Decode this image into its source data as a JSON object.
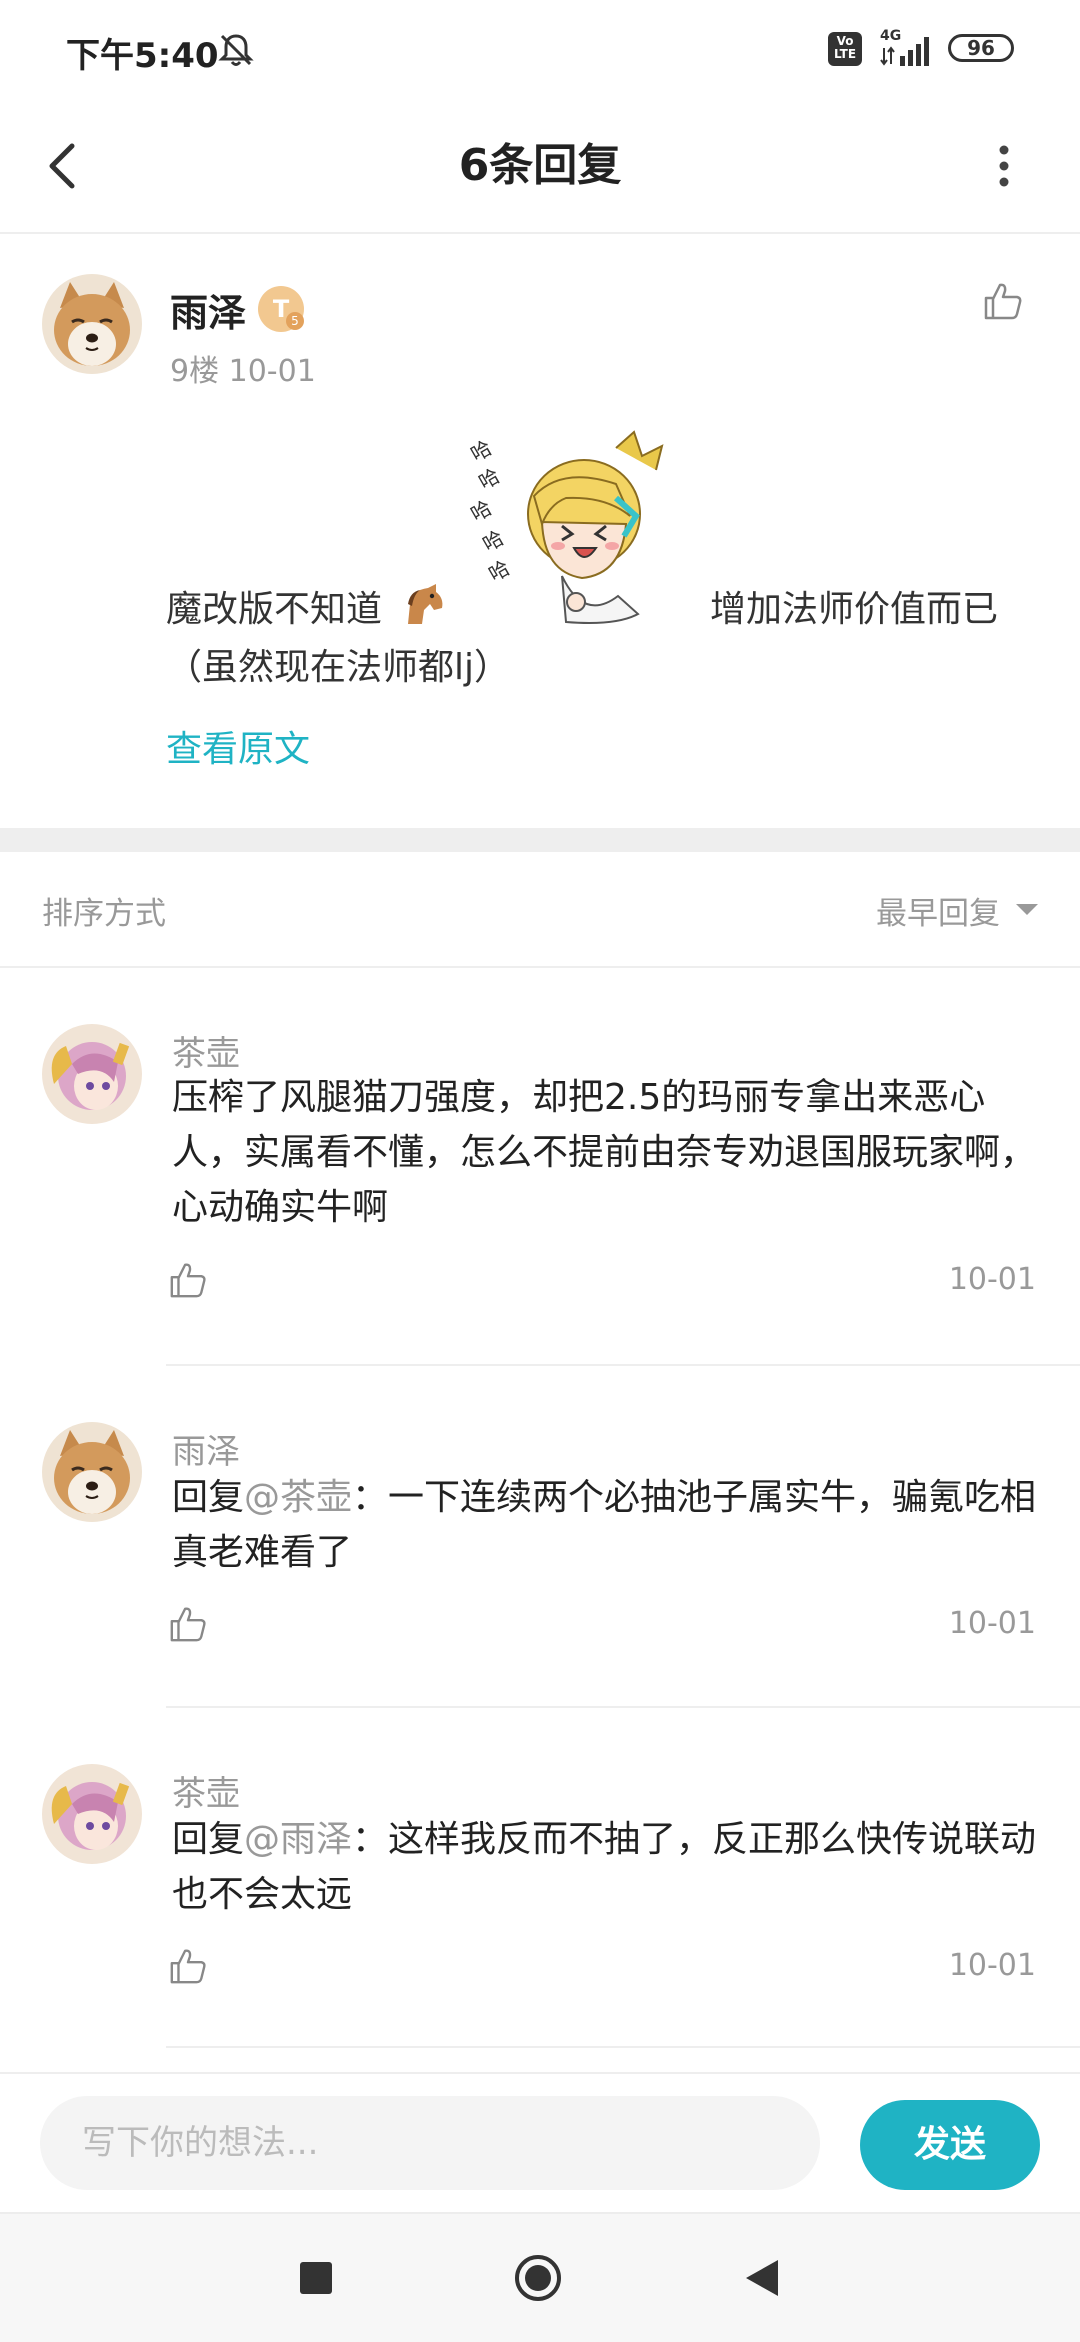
{
  "status_bar": {
    "time": "下午5:40",
    "volte": "Vo LTE",
    "network": "4G",
    "battery": "96"
  },
  "header": {
    "title": "6条回复"
  },
  "post": {
    "username": "雨泽",
    "badge": "T",
    "badge_sub": "5",
    "meta": "9楼   10-01",
    "text_part1": "魔改版不知道",
    "text_part2": "增加法师价值而已",
    "text_line2": "（虽然现在法师都lj）",
    "view_original": "查看原文"
  },
  "sort": {
    "label": "排序方式",
    "value": "最早回复"
  },
  "replies": [
    {
      "name": "茶壶",
      "at": "",
      "text": "压榨了风腿猫刀强度，却把2.5的玛丽专拿出来恶心人，实属看不懂，怎么不提前由奈专劝退国服玩家啊，心动确实牛啊",
      "date": "10-01"
    },
    {
      "name": "雨泽",
      "prefix": "回复",
      "at": "@茶壶",
      "text": "：一下连续两个必抽池子属实牛，骗氪吃相真老难看了",
      "date": "10-01"
    },
    {
      "name": "茶壶",
      "prefix": "回复",
      "at": "@雨泽",
      "text": "：这样我反而不抽了，反正那么快传说联动也不会太远",
      "date": "10-01"
    }
  ],
  "input": {
    "placeholder": "写下你的想法...",
    "send_label": "发送"
  },
  "colors": {
    "accent": "#1fb3c4",
    "muted": "#999999"
  }
}
